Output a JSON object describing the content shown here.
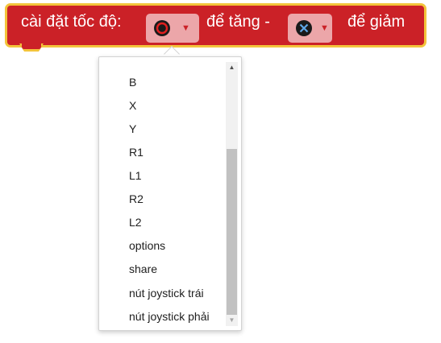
{
  "block": {
    "label_prefix": "cài đặt tốc độ:",
    "label_increase": "để tăng -",
    "label_decrease": "để giảm",
    "increase_field": {
      "icon": "circle-button-icon"
    },
    "decrease_field": {
      "icon": "cross-button-icon"
    },
    "color": "#cb2127",
    "border_color": "#f3c43b"
  },
  "dropdown": {
    "items": [
      "B",
      "X",
      "Y",
      "R1",
      "L1",
      "R2",
      "L2",
      "options",
      "share",
      "nút joystick trái",
      "nút joystick phải"
    ]
  }
}
